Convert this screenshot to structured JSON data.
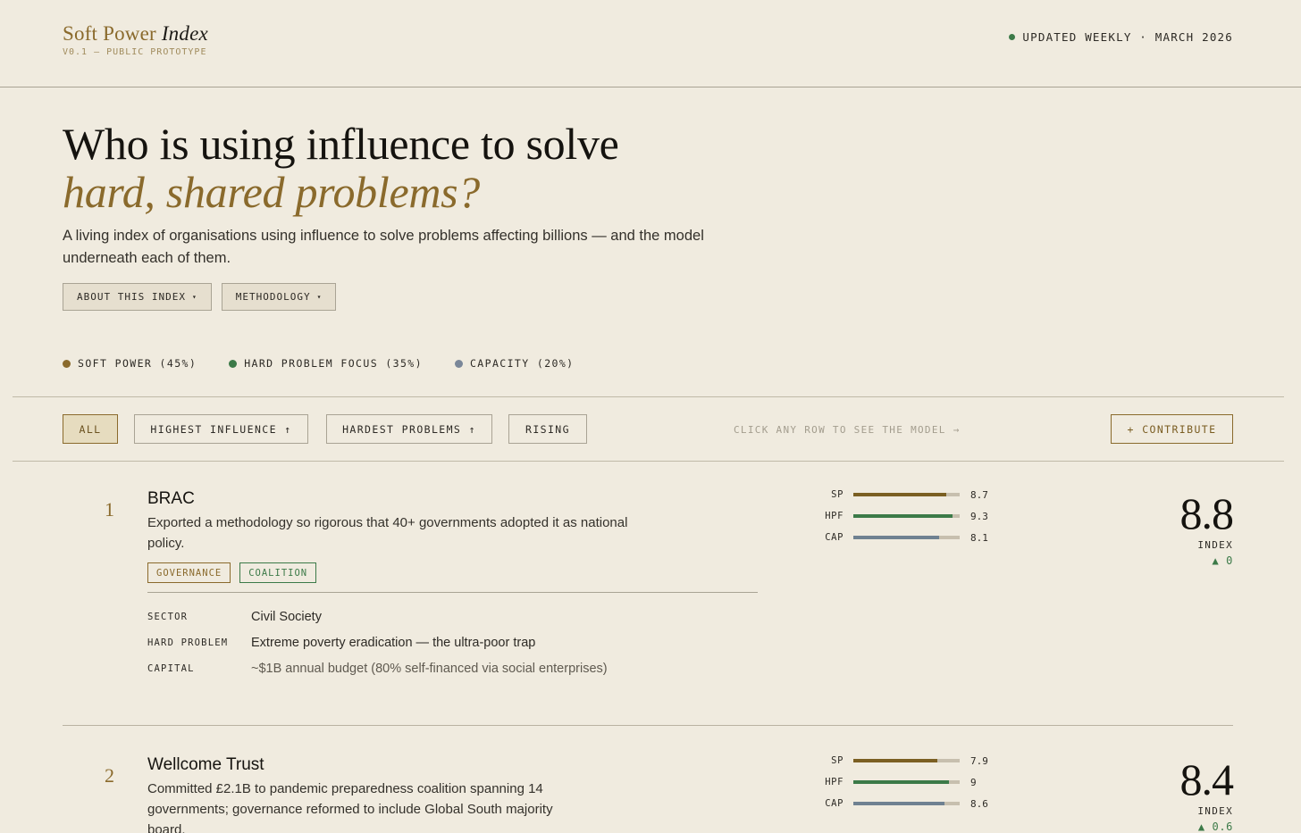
{
  "brand": {
    "name_plain": "Soft Power",
    "name_italic": "Index",
    "subtitle": "V0.1 — PUBLIC PROTOTYPE"
  },
  "status": {
    "text": "UPDATED WEEKLY · MARCH 2026",
    "dot_color": "#3c7a48"
  },
  "hero": {
    "title_line1": "Who is using influence to solve",
    "title_line2": "hard, shared problems?",
    "description": "A living index of organisations using influence to solve problems affecting billions — and the model underneath each of them.",
    "buttons": [
      {
        "label": "ABOUT THIS INDEX",
        "caret": "▾"
      },
      {
        "label": "METHODOLOGY",
        "caret": "▾"
      }
    ]
  },
  "legend": [
    {
      "label": "SOFT POWER (45%)",
      "color": "#8a6a2c"
    },
    {
      "label": "HARD PROBLEM FOCUS (35%)",
      "color": "#3c7a48"
    },
    {
      "label": "CAPACITY (20%)",
      "color": "#7a8799"
    }
  ],
  "filters": {
    "items": [
      {
        "label": "ALL",
        "active": true
      },
      {
        "label": "HIGHEST INFLUENCE ↑",
        "active": false
      },
      {
        "label": "HARDEST PROBLEMS ↑",
        "active": false
      },
      {
        "label": "RISING",
        "active": false
      }
    ],
    "hint": "CLICK ANY ROW TO SEE THE MODEL →",
    "contribute_label": "+ CONTRIBUTE"
  },
  "colors": {
    "sp": "#7b5f22",
    "hpf": "#3c7a48",
    "cap": "#6f8191",
    "gold": "#8a6a2c",
    "green": "#3c7a48"
  },
  "entries": [
    {
      "rank": "1",
      "name": "BRAC",
      "description": "Exported a methodology so rigorous that 40+ governments adopted it as national policy.",
      "tags": [
        {
          "label": "GOVERNANCE",
          "tone": "gold"
        },
        {
          "label": "COALITION",
          "tone": "green"
        }
      ],
      "details": [
        {
          "key": "SECTOR",
          "value": "Civil Society",
          "muted": false
        },
        {
          "key": "HARD PROBLEM",
          "value": "Extreme poverty eradication — the ultra-poor trap",
          "muted": false
        },
        {
          "key": "CAPITAL",
          "value": "~$1B annual budget (80% self-financed via social enterprises)",
          "muted": true
        }
      ],
      "metrics": [
        {
          "label": "SP",
          "value": 8.7,
          "display": "8.7"
        },
        {
          "label": "HPF",
          "value": 9.3,
          "display": "9.3"
        },
        {
          "label": "CAP",
          "value": 8.1,
          "display": "8.1"
        }
      ],
      "score": "8.8",
      "score_label": "INDEX",
      "delta": "▲ 0"
    },
    {
      "rank": "2",
      "name": "Wellcome Trust",
      "description": "Committed £2.1B to pandemic preparedness coalition spanning 14 governments; governance reformed to include Global South majority board.",
      "tags": [],
      "details": [],
      "metrics": [
        {
          "label": "SP",
          "value": 7.9,
          "display": "7.9"
        },
        {
          "label": "HPF",
          "value": 9,
          "display": "9"
        },
        {
          "label": "CAP",
          "value": 8.6,
          "display": "8.6"
        }
      ],
      "score": "8.4",
      "score_label": "INDEX",
      "delta": "▲ 0.6"
    }
  ]
}
